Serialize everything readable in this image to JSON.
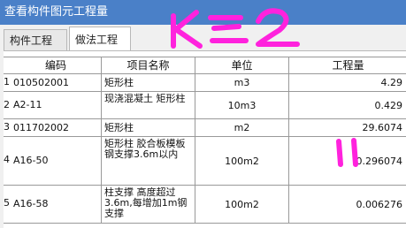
{
  "window": {
    "title": "查看构件图元工程量"
  },
  "tabs": [
    {
      "label": "构件工程量"
    },
    {
      "label": "做法工程量"
    }
  ],
  "table": {
    "headers": [
      "编码",
      "项目名称",
      "单位",
      "工程量"
    ],
    "rows": [
      {
        "index": "1",
        "code": "010502001",
        "name": "矩形柱",
        "unit": "m3",
        "qty": "4.29"
      },
      {
        "index": "2",
        "code": "A2-11",
        "name": "现浇混凝土 矩形柱",
        "unit": "10m3",
        "qty": "0.429"
      },
      {
        "index": "3",
        "code": "011702002",
        "name": "矩形柱",
        "unit": "m2",
        "qty": "29.6074"
      },
      {
        "index": "4",
        "code": "A16-50",
        "name": "矩形柱 胶合板模板 钢支撑3.6m以内",
        "unit": "100m2",
        "qty": "0.296074"
      },
      {
        "index": "5",
        "code": "A16-58",
        "name": "柱支撑 高度超过3.6m,每增加1m钢支撑",
        "unit": "100m2",
        "qty": "0.006276"
      }
    ]
  },
  "annotation": {
    "color": "#ff22dd"
  }
}
